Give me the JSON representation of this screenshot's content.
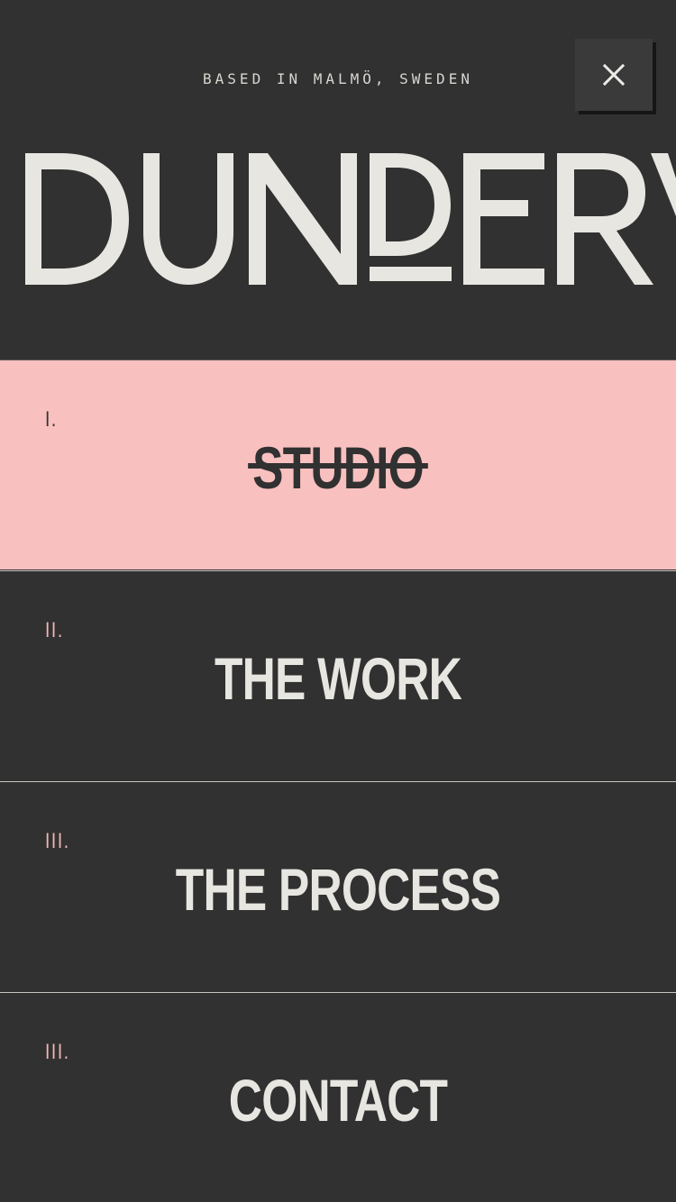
{
  "header": {
    "tagline": "BASED IN MALMÖ, SWEDEN",
    "logo_text": "DUNDERV",
    "close_icon": "close-icon"
  },
  "menu": {
    "items": [
      {
        "numeral": "I.",
        "label": "STUDIO",
        "active": true
      },
      {
        "numeral": "II.",
        "label": "THE WORK",
        "active": false
      },
      {
        "numeral": "III.",
        "label": "THE PROCESS",
        "active": false
      },
      {
        "numeral": "III.",
        "label": "CONTACT",
        "active": false
      }
    ]
  },
  "colors": {
    "background": "#313131",
    "accent_pink": "#f9c0c0",
    "numeral_pink": "#f4b6b6",
    "text_light": "#e8e6e1"
  }
}
